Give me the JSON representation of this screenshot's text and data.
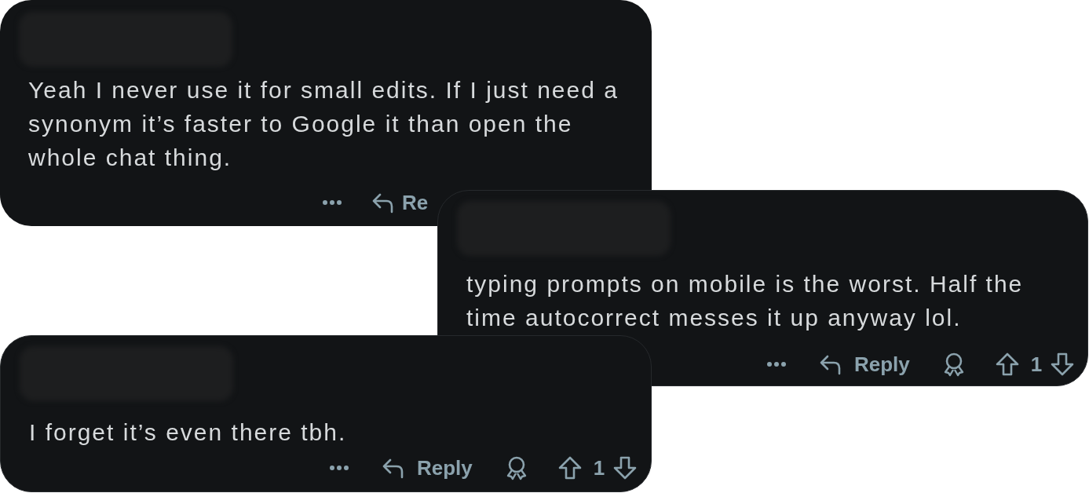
{
  "comments": [
    {
      "body": "Yeah I never use it for small edits. If I just need a synonym it’s faster to Google it than open the whole chat thing.",
      "reply_label": "Re"
    },
    {
      "body": "typing prompts on mobile is the worst. Half the time autocorrect messes it up anyway lol.",
      "reply_label": "Reply",
      "award": true,
      "score": "1"
    },
    {
      "body": "I forget it’s even there tbh.",
      "reply_label": "Reply",
      "award": true,
      "score": "1"
    }
  ]
}
